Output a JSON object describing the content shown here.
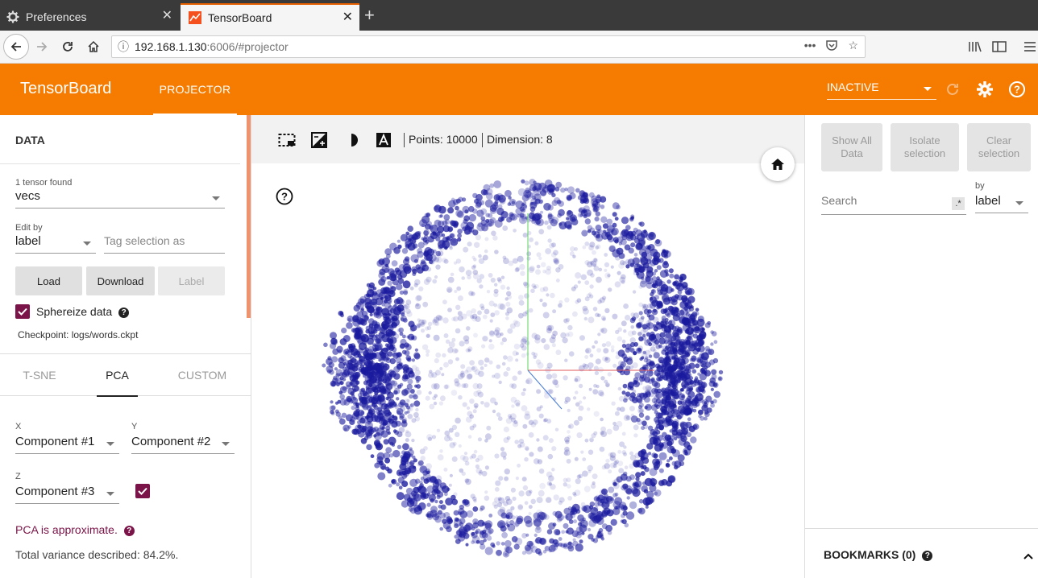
{
  "browser": {
    "tabs": [
      {
        "title": "Preferences",
        "icon": "gear-icon",
        "active": false
      },
      {
        "title": "TensorBoard",
        "icon": "tensorboard-favicon",
        "active": true
      }
    ],
    "url": {
      "host": "192.168.1.130",
      "rest": ":6006/#projector"
    }
  },
  "app": {
    "brand": "TensorBoard",
    "tab_label": "PROJECTOR",
    "run_status": "INACTIVE",
    "accent": "#f57c00"
  },
  "data_panel": {
    "title": "DATA",
    "tensor_count": "1 tensor found",
    "tensor": "vecs",
    "edit_by_label": "Edit by",
    "edit_by": "label",
    "tag_placeholder": "Tag selection as",
    "load": "Load",
    "download": "Download",
    "label_btn": "Label",
    "sphereize": "Sphereize data",
    "checkpoint": "Checkpoint: logs/words.ckpt"
  },
  "projection": {
    "tabs": [
      "T-SNE",
      "PCA",
      "CUSTOM"
    ],
    "active_tab": "PCA",
    "x_label": "X",
    "x_value": "Component #1",
    "y_label": "Y",
    "y_value": "Component #2",
    "z_label": "Z",
    "z_value": "Component #3",
    "approx": "PCA is approximate.",
    "variance": "Total variance described: 84.2%."
  },
  "toolbar": {
    "points": "Points: 10000",
    "dimension": "Dimension: 8"
  },
  "inspector": {
    "show_all": "Show All Data",
    "isolate": "Isolate selection",
    "clear": "Clear selection",
    "search_placeholder": "Search",
    "regex": ".*",
    "by_label": "by",
    "by_value": "label",
    "bookmarks": "BOOKMARKS (0)"
  },
  "colors": {
    "point": "#1a1a9e",
    "checkbox": "#7b1448",
    "accent_link": "#7b1448"
  }
}
